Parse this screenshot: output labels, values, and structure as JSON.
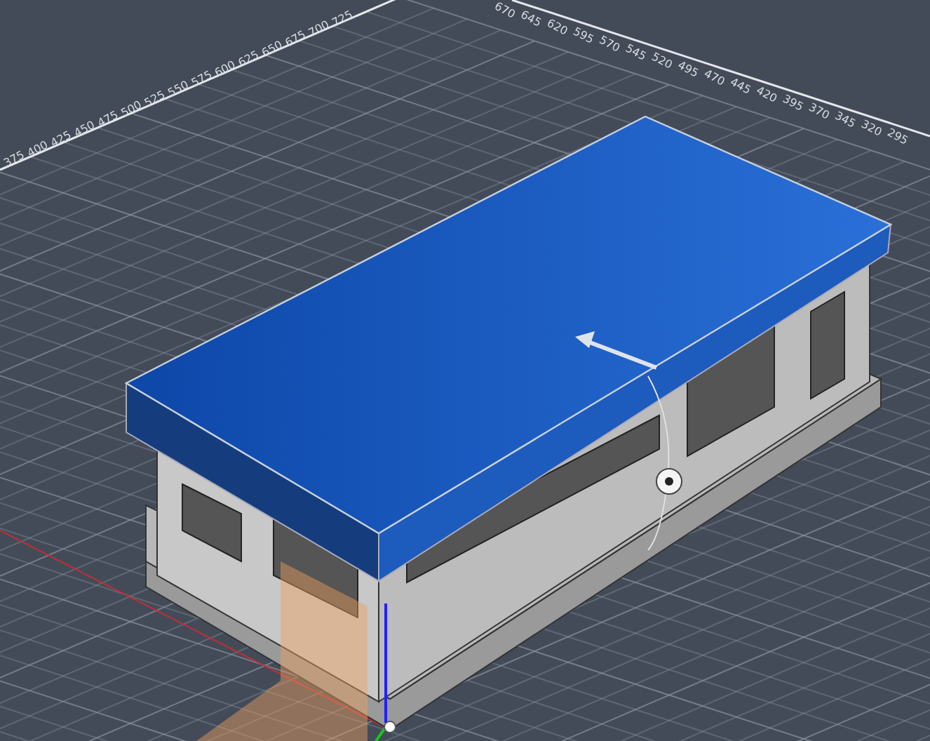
{
  "viewport": {
    "ruler_left": {
      "labels": [
        "375",
        "400",
        "425",
        "450",
        "475",
        "500",
        "525",
        "550",
        "575",
        "600",
        "625",
        "650",
        "675",
        "700",
        "725"
      ]
    },
    "ruler_right": {
      "labels": [
        "670",
        "645",
        "620",
        "595",
        "570",
        "545",
        "520",
        "495",
        "470",
        "445",
        "420",
        "395",
        "370",
        "345",
        "320",
        "295"
      ]
    }
  }
}
